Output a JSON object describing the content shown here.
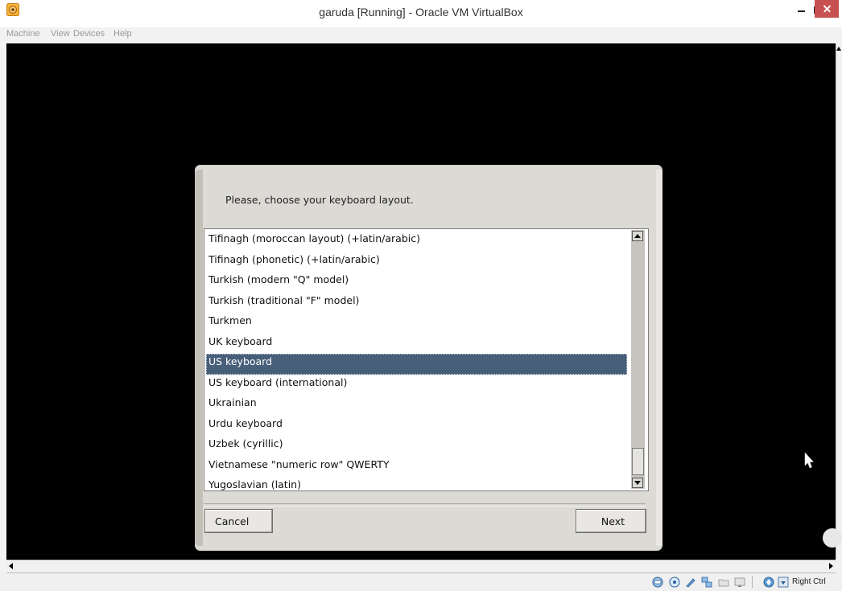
{
  "window": {
    "title": "garuda [Running] - Oracle VM VirtualBox"
  },
  "menubar": {
    "items": [
      "Machine",
      "View",
      "Devices",
      "Help"
    ]
  },
  "dialog": {
    "prompt": "Please, choose your keyboard layout.",
    "layouts": [
      "Tifinagh (moroccan layout) (+latin/arabic)",
      "Tifinagh (phonetic) (+latin/arabic)",
      "Turkish (modern \"Q\" model)",
      "Turkish (traditional \"F\" model)",
      "Turkmen",
      "UK keyboard",
      "US keyboard",
      "US keyboard (international)",
      "Ukrainian",
      "Urdu keyboard",
      "Uzbek (cyrillic)",
      "Vietnamese \"numeric row\" QWERTY",
      "Yugoslavian (latin)"
    ],
    "selected_layout": "US keyboard",
    "cancel_label": "Cancel",
    "next_label": "Next"
  },
  "statusbar": {
    "icons": [
      "hard-disk-icon",
      "optical-drive-icon",
      "audio-icon",
      "network-icon",
      "shared-folders-icon",
      "display-icon",
      "mouse-integration-icon",
      "keyboard-icon"
    ],
    "host_key": "Right Ctrl"
  },
  "colors": {
    "selection": "#485f7a",
    "vm_background": "#000000",
    "dialog_background": "#dcdad5",
    "close_button": "#c75050"
  }
}
